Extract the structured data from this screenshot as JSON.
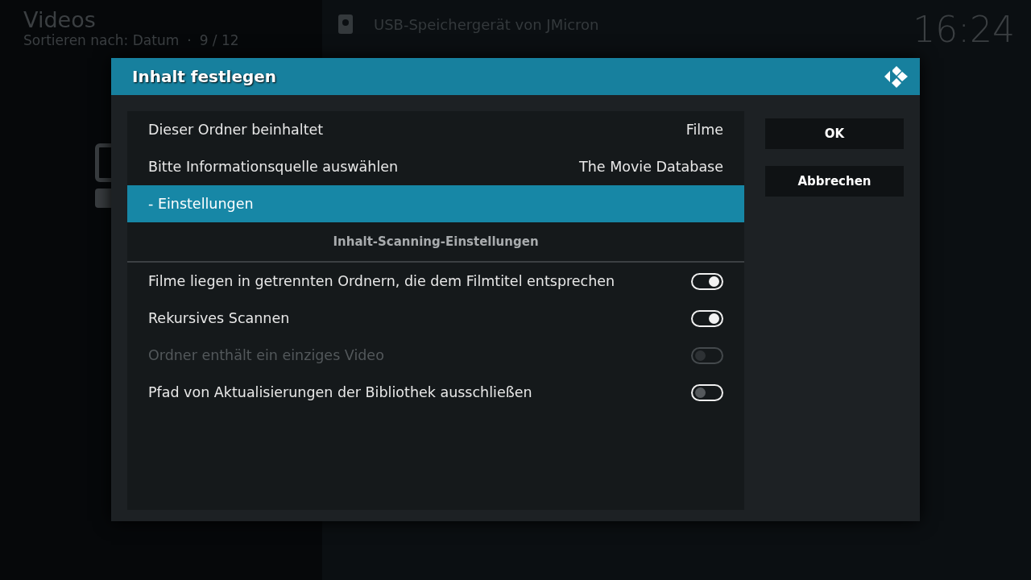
{
  "background": {
    "title": "Videos",
    "subtitle": "Sortieren nach: Datum",
    "separator": "·",
    "position": "9 / 12",
    "clock": "16:24",
    "list_items": [
      {
        "label": "USB-Speichergerät von JMicron"
      }
    ]
  },
  "dialog": {
    "title": "Inhalt festlegen",
    "rows": [
      {
        "kind": "value",
        "label": "Dieser Ordner beinhaltet",
        "value": "Filme",
        "selected": false
      },
      {
        "kind": "value",
        "label": "Bitte Informationsquelle auswählen",
        "value": "The Movie Database",
        "selected": false
      },
      {
        "kind": "value",
        "label": "- Einstellungen",
        "selected": true
      },
      {
        "kind": "header",
        "label": "Inhalt-Scanning-Einstellungen",
        "selected": false
      },
      {
        "kind": "toggle",
        "label": "Filme liegen in getrennten Ordnern, die dem Filmtitel entsprechen",
        "on": true,
        "disabled": false,
        "selected": false
      },
      {
        "kind": "toggle",
        "label": "Rekursives Scannen",
        "on": true,
        "disabled": false,
        "selected": false
      },
      {
        "kind": "toggle",
        "label": "Ordner enthält ein einziges Video",
        "on": false,
        "disabled": true,
        "selected": false
      },
      {
        "kind": "toggle",
        "label": "Pfad von Aktualisierungen der Bibliothek ausschließen",
        "on": false,
        "disabled": false,
        "selected": false
      }
    ],
    "buttons": [
      {
        "label": "OK",
        "selected": false
      },
      {
        "label": "Abbrechen",
        "selected": false
      }
    ]
  }
}
